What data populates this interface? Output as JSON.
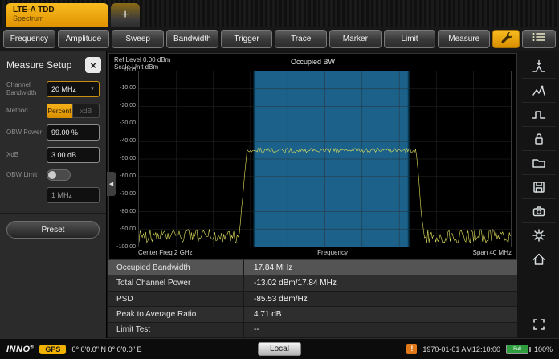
{
  "window": {
    "tab": {
      "title": "LTE-A TDD",
      "subtitle": "Spectrum"
    },
    "new_tab_label": "+"
  },
  "menubar": {
    "buttons": [
      "Frequency",
      "Amplitude",
      "Sweep",
      "Bandwidth",
      "Trigger",
      "Trace",
      "Marker",
      "Limit",
      "Measure"
    ],
    "icons": [
      "wrench-icon",
      "list-icon"
    ]
  },
  "measure_setup": {
    "title": "Measure Setup",
    "close_label": "×",
    "fields": {
      "channel_bandwidth": {
        "label": "Channel Bandwidth",
        "value": "20 MHz"
      },
      "method": {
        "label": "Method",
        "options": [
          "Percent",
          "xdB"
        ],
        "selected": "Percent"
      },
      "obw_power": {
        "label": "OBW Power",
        "value": "99.00 %"
      },
      "xdb": {
        "label": "XdB",
        "value": "3.00 dB"
      },
      "obw_limit": {
        "label": "OBW Limit",
        "state": "off",
        "value": "1 MHz"
      }
    },
    "preset_button": "Preset"
  },
  "chart": {
    "ref_level_label": "Ref Level 0.00 dBm",
    "scale_unit_label": "Scale Unit  dBm",
    "title": "Occupied BW",
    "x_left": "Center Freq 2 GHz",
    "x_center": "Frequency",
    "x_right": "Span 40 MHz",
    "y_ticks": [
      "0.00",
      "-10.00",
      "-20.00",
      "-30.00",
      "-40.00",
      "-50.00",
      "-60.00",
      "-70.00",
      "-80.00",
      "-90.00",
      "-100.00"
    ]
  },
  "chart_data": {
    "type": "line",
    "title": "Occupied BW",
    "xlabel": "Frequency",
    "ylabel": "dBm",
    "center_freq": "2 GHz",
    "span": "40 MHz",
    "ref_level_dbm": 0,
    "ylim": [
      -100,
      0
    ],
    "grid": true,
    "noise_floor_dbm": -94,
    "signal_top_dbm": -45,
    "signal_start_frac": 0.27,
    "signal_stop_frac": 0.765,
    "obw_region_frac": [
      0.31,
      0.725
    ],
    "occupied_bandwidth": "17.84 MHz",
    "trace_color": "#e4e45e",
    "region_color": "#1f6e9c"
  },
  "results": {
    "rows": [
      {
        "label": "Occupied Bandwidth",
        "value": "17.84 MHz"
      },
      {
        "label": "Total Channel Power",
        "value": "-13.02 dBm/17.84 MHz"
      },
      {
        "label": "PSD",
        "value": "-85.53 dBm/Hz"
      },
      {
        "label": "Peak to Average Ratio",
        "value": "4.71 dB"
      },
      {
        "label": "Limit Test",
        "value": "--"
      }
    ]
  },
  "right_toolbar": {
    "icons": [
      "peak-search-icon",
      "trace-peak-icon",
      "pulse-waveform-icon",
      "lock-icon",
      "folder-icon",
      "save-icon",
      "camera-icon",
      "settings-gear-icon",
      "home-icon",
      "fullscreen-icon"
    ]
  },
  "statusbar": {
    "brand": "INNO",
    "gps_label": "GPS",
    "gps_coords": "0° 0'0.0\" N 0° 0'0.0\" E",
    "local_button": "Local",
    "datetime": "1970-01-01  AM12:10:00",
    "battery_label": "Full",
    "battery_percent": "100%"
  }
}
